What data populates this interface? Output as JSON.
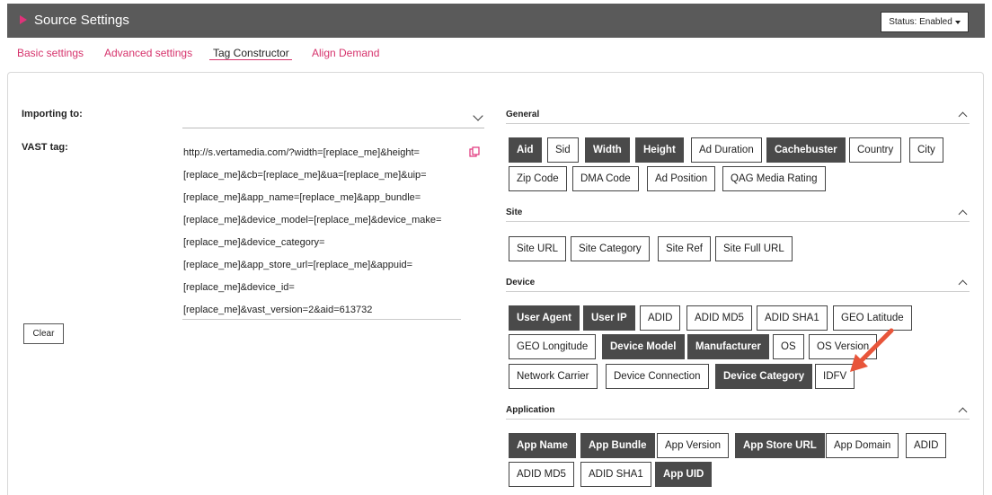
{
  "header": {
    "title": "Source Settings",
    "status_label": "Status: Enabled"
  },
  "tabs": [
    "Basic settings",
    "Advanced settings",
    "Tag Constructor",
    "Align Demand"
  ],
  "form": {
    "importing_label": "Importing to:",
    "importing_value": "",
    "vast_label": "VAST tag:",
    "vast_lines": [
      "http://s.vertamedia.com/?width=[replace_me]&height=",
      "[replace_me]&cb=[replace_me]&ua=[replace_me]&uip=",
      "[replace_me]&app_name=[replace_me]&app_bundle=",
      "[replace_me]&device_model=[replace_me]&device_make=",
      "[replace_me]&device_category=",
      "[replace_me]&app_store_url=[replace_me]&appuid=",
      "[replace_me]&device_id=",
      "[replace_me]&vast_version=2&aid=613732"
    ],
    "clear_label": "Clear"
  },
  "sections": {
    "general": {
      "title": "General",
      "chips": [
        {
          "label": "Aid",
          "on": true
        },
        {
          "label": "Sid",
          "on": false
        },
        {
          "label": "Width",
          "on": true
        },
        {
          "label": "Height",
          "on": true
        },
        {
          "label": "Ad Duration",
          "on": false
        },
        {
          "label": "Cachebuster",
          "on": true
        },
        {
          "label": "Country",
          "on": false
        },
        {
          "label": "City",
          "on": false
        },
        {
          "label": "Zip Code",
          "on": false
        },
        {
          "label": "DMA Code",
          "on": false
        },
        {
          "label": "Ad Position",
          "on": false
        },
        {
          "label": "QAG Media Rating",
          "on": false
        }
      ]
    },
    "site": {
      "title": "Site",
      "chips": [
        {
          "label": "Site URL",
          "on": false
        },
        {
          "label": "Site Category",
          "on": false
        },
        {
          "label": "Site Ref",
          "on": false
        },
        {
          "label": "Site Full URL",
          "on": false
        }
      ]
    },
    "device": {
      "title": "Device",
      "chips": [
        {
          "label": "User Agent",
          "on": true
        },
        {
          "label": "User IP",
          "on": true
        },
        {
          "label": "ADID",
          "on": false
        },
        {
          "label": "ADID MD5",
          "on": false
        },
        {
          "label": "ADID SHA1",
          "on": false
        },
        {
          "label": "GEO Latitude",
          "on": false
        },
        {
          "label": "GEO Longitude",
          "on": false
        },
        {
          "label": "Device Model",
          "on": true
        },
        {
          "label": "Manufacturer",
          "on": true
        },
        {
          "label": "OS",
          "on": false
        },
        {
          "label": "OS Version",
          "on": false
        },
        {
          "label": "Network Carrier",
          "on": false
        },
        {
          "label": "Device Connection",
          "on": false
        },
        {
          "label": "Device Category",
          "on": true
        },
        {
          "label": "IDFV",
          "on": false
        }
      ]
    },
    "application": {
      "title": "Application",
      "chips": [
        {
          "label": "App Name",
          "on": true
        },
        {
          "label": "App Bundle",
          "on": true
        },
        {
          "label": "App Version",
          "on": false
        },
        {
          "label": "App Store URL",
          "on": true
        },
        {
          "label": "App Domain",
          "on": false
        },
        {
          "label": "ADID",
          "on": false
        },
        {
          "label": "ADID MD5",
          "on": false
        },
        {
          "label": "ADID SHA1",
          "on": false
        },
        {
          "label": "App UID",
          "on": true
        }
      ]
    }
  },
  "colors": {
    "accent": "#d6336c",
    "header_bg": "#5a5a5a",
    "chip_on": "#4a4a4a",
    "arrow": "#e8553a"
  }
}
